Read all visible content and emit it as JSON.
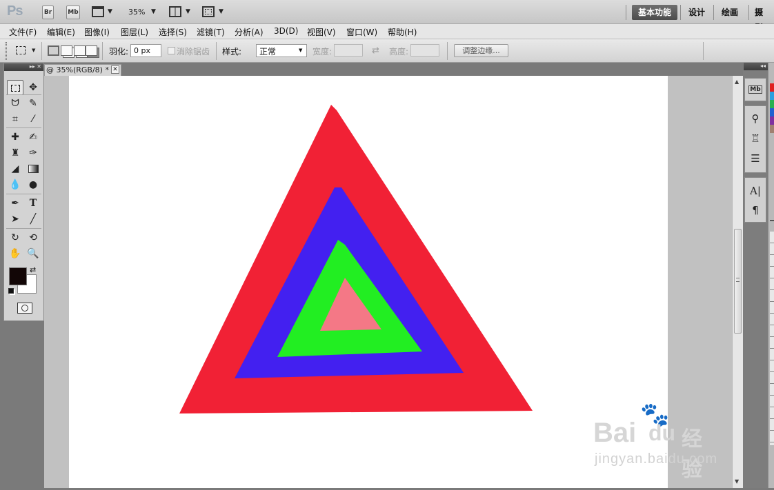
{
  "app": {
    "logo": "Ps",
    "br_label": "Br",
    "mb_label": "Mb",
    "zoom": "35%"
  },
  "workspaces": [
    {
      "label": "基本功能",
      "active": true
    },
    {
      "label": "设计"
    },
    {
      "label": "绘画"
    },
    {
      "label": "摄影"
    }
  ],
  "menu": [
    "文件(F)",
    "编辑(E)",
    "图像(I)",
    "图层(L)",
    "选择(S)",
    "滤镜(T)",
    "分析(A)",
    "3D(D)",
    "视图(V)",
    "窗口(W)",
    "帮助(H)"
  ],
  "options": {
    "feather_label": "羽化:",
    "feather_value": "0 px",
    "antialias_label": "消除锯齿",
    "style_label": "样式:",
    "style_value": "正常",
    "width_label": "宽度:",
    "height_label": "高度:",
    "refine_edge_label": "调整边缘..."
  },
  "document": {
    "tab_title": "@ 35%(RGB/8) *"
  },
  "artwork": {
    "outer_color": "#f12135",
    "second_color": "#4320f0",
    "third_color": "#22ee22",
    "inner_color": "#f47886"
  },
  "colors": {
    "foreground": "#120606",
    "background": "#ffffff"
  },
  "watermark": {
    "brand": "Bai",
    "brand_suffix": "du",
    "site": "经验",
    "url": "jingyan.baidu.com"
  }
}
